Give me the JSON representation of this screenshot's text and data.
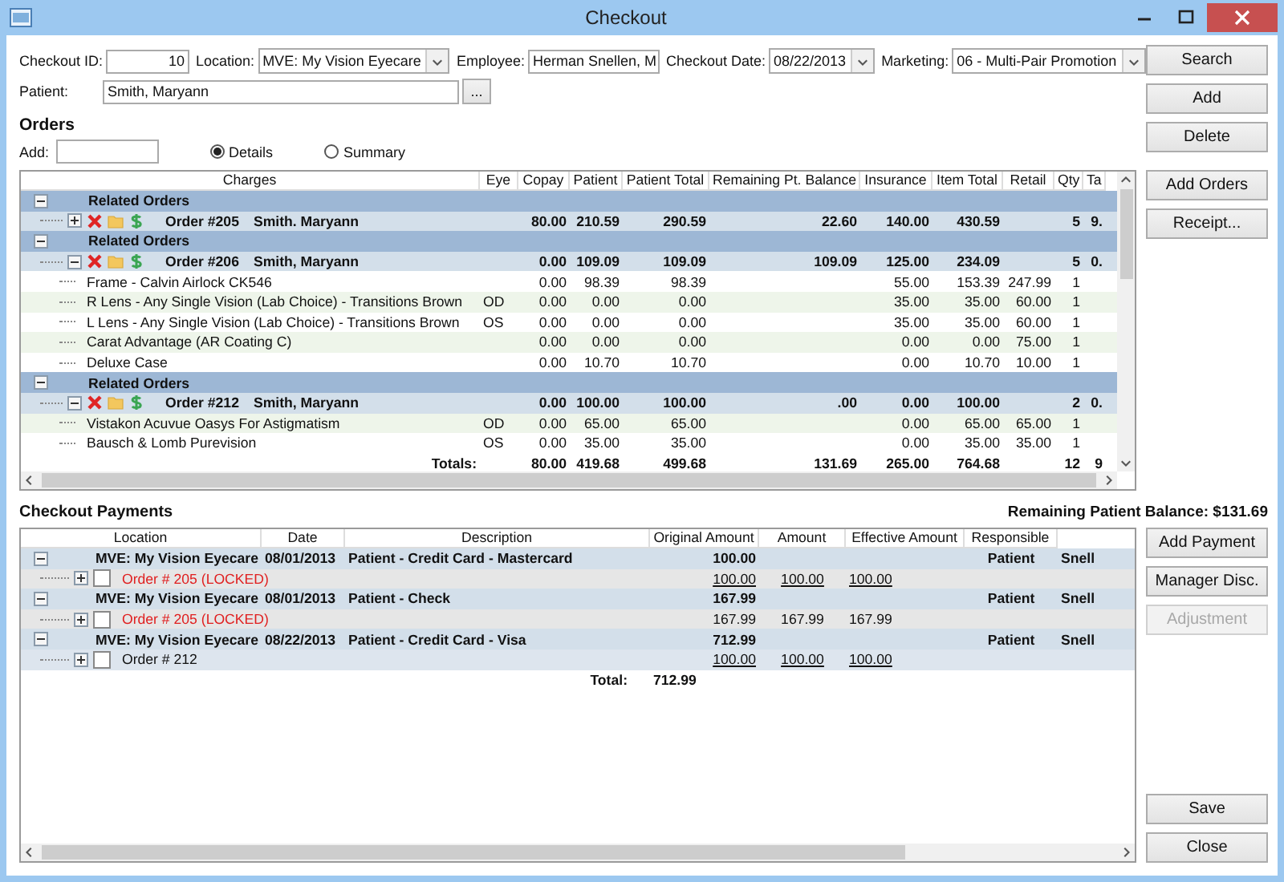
{
  "window": {
    "title": "Checkout"
  },
  "form": {
    "rows": [
      [
        {
          "label": "Checkout ID:",
          "value": "10",
          "kind": "number"
        },
        {
          "label": "Location:",
          "value": "MVE: My Vision Eyecare",
          "kind": "dropdown"
        },
        {
          "label": "Employee:",
          "value": "Herman Snellen, M",
          "kind": "text"
        },
        {
          "label": "Checkout Date:",
          "value": "08/22/2013",
          "kind": "date"
        },
        {
          "label": "Marketing:",
          "value": "06 - Multi-Pair Promotion",
          "kind": "dropdown"
        }
      ],
      [
        {
          "label": "Patient:",
          "value": "Smith, Maryann",
          "kind": "lookup",
          "button": "..."
        }
      ]
    ]
  },
  "top_buttons": [
    "Search",
    "Add",
    "Delete"
  ],
  "orders": {
    "title": "Orders",
    "add_label": "Add:",
    "view_options": [
      {
        "label": "Details",
        "selected": true
      },
      {
        "label": "Summary",
        "selected": false
      }
    ],
    "buttons": [
      "Add Orders",
      "Receipt..."
    ],
    "columns": [
      "Charges",
      "Eye",
      "Copay",
      "Patient",
      "Patient Total",
      "Remaining Pt. Balance",
      "Insurance",
      "Item Total",
      "Retail",
      "Qty",
      "Ta"
    ],
    "rows": [
      {
        "kind": "group",
        "label": "Related Orders",
        "expanded": true,
        "children": [
          {
            "kind": "order",
            "number": "Order #205",
            "patient": "Smith. Maryann",
            "expanded": false,
            "cells": [
              null,
              "80.00",
              "210.59",
              "290.59",
              "22.60",
              "140.00",
              "430.59",
              null,
              "5",
              "9."
            ]
          }
        ]
      },
      {
        "kind": "group",
        "label": "Related Orders",
        "expanded": true,
        "children": [
          {
            "kind": "order",
            "number": "Order #206",
            "patient": "Smith, Maryann",
            "expanded": true,
            "cells": [
              null,
              "0.00",
              "109.09",
              "109.09",
              "109.09",
              "125.00",
              "234.09",
              null,
              "5",
              "0."
            ],
            "children": [
              {
                "kind": "item",
                "description": "Frame - Calvin Airlock CK546",
                "cells": [
                  null,
                  "0.00",
                  "98.39",
                  "98.39",
                  null,
                  "55.00",
                  "153.39",
                  "247.99",
                  "1",
                  null
                ]
              },
              {
                "kind": "item",
                "description": "R Lens - Any Single Vision (Lab Choice) - Transitions Brown",
                "cells": [
                  "OD",
                  "0.00",
                  "0.00",
                  "0.00",
                  null,
                  "35.00",
                  "35.00",
                  "60.00",
                  "1",
                  null
                ]
              },
              {
                "kind": "item",
                "description": "L Lens - Any Single Vision (Lab Choice) - Transitions Brown",
                "cells": [
                  "OS",
                  "0.00",
                  "0.00",
                  "0.00",
                  null,
                  "35.00",
                  "35.00",
                  "60.00",
                  "1",
                  null
                ]
              },
              {
                "kind": "item",
                "description": "Carat Advantage (AR Coating C)",
                "cells": [
                  null,
                  "0.00",
                  "0.00",
                  "0.00",
                  null,
                  "0.00",
                  "0.00",
                  "75.00",
                  "1",
                  null
                ]
              },
              {
                "kind": "item",
                "description": "Deluxe Case",
                "cells": [
                  null,
                  "0.00",
                  "10.70",
                  "10.70",
                  null,
                  "0.00",
                  "10.70",
                  "10.00",
                  "1",
                  null
                ]
              }
            ]
          }
        ]
      },
      {
        "kind": "group",
        "label": "Related Orders",
        "expanded": true,
        "children": [
          {
            "kind": "order",
            "number": "Order #212",
            "patient": "Smith, Maryann",
            "expanded": true,
            "cells": [
              null,
              "0.00",
              "100.00",
              "100.00",
              ".00",
              "0.00",
              "100.00",
              null,
              "2",
              "0."
            ],
            "children": [
              {
                "kind": "item",
                "description": "Vistakon Acuvue Oasys For Astigmatism",
                "cells": [
                  "OD",
                  "0.00",
                  "65.00",
                  "65.00",
                  null,
                  "0.00",
                  "65.00",
                  "65.00",
                  "1",
                  null
                ]
              },
              {
                "kind": "item",
                "description": "Bausch & Lomb Purevision",
                "cells": [
                  "OS",
                  "0.00",
                  "35.00",
                  "35.00",
                  null,
                  "0.00",
                  "35.00",
                  "35.00",
                  "1",
                  null
                ]
              }
            ]
          }
        ]
      }
    ],
    "totals": {
      "label": "Totals:",
      "cells": [
        null,
        "80.00",
        "419.68",
        "499.68",
        "131.69",
        "265.00",
        "764.68",
        null,
        "12",
        "9"
      ]
    }
  },
  "payments": {
    "title": "Checkout Payments",
    "balance": "Remaining Patient Balance: $131.69",
    "buttons": [
      {
        "label": "Add Payment",
        "disabled": false
      },
      {
        "label": "Manager Disc.",
        "disabled": false
      },
      {
        "label": "Adjustment",
        "disabled": true
      }
    ],
    "columns": [
      "Location",
      "Date",
      "Description",
      "Original Amount",
      "Amount",
      "Effective Amount",
      "Responsible"
    ],
    "rows": [
      {
        "location": "MVE: My Vision Eyecare",
        "date": "08/01/2013",
        "description": "Patient - Credit Card - Mastercard",
        "original_amount": "100.00",
        "responsible": "Patient",
        "column_8": "Snell",
        "expanded": true,
        "children": [
          {
            "order": "Order # 205 (LOCKED)",
            "locked": true,
            "checked": false,
            "expanded": false,
            "linked": true,
            "original_amount": "100.00",
            "amount": "100.00",
            "effective_amount": "100.00"
          }
        ]
      },
      {
        "location": "MVE: My Vision Eyecare",
        "date": "08/01/2013",
        "description": "Patient - Check",
        "original_amount": "167.99",
        "responsible": "Patient",
        "column_8": "Snell",
        "expanded": true,
        "children": [
          {
            "order": "Order # 205 (LOCKED)",
            "locked": true,
            "checked": false,
            "expanded": false,
            "linked": false,
            "original_amount": "167.99",
            "amount": "167.99",
            "effective_amount": "167.99"
          }
        ]
      },
      {
        "location": "MVE: My Vision Eyecare",
        "date": "08/22/2013",
        "description": "Patient - Credit Card - Visa",
        "original_amount": "712.99",
        "responsible": "Patient",
        "column_8": "Snell",
        "expanded": true,
        "children": [
          {
            "order": "Order # 212",
            "locked": false,
            "checked": false,
            "expanded": false,
            "linked": true,
            "original_amount": "100.00",
            "amount": "100.00",
            "effective_amount": "100.00"
          }
        ]
      }
    ],
    "total": {
      "label": "Total:",
      "value": "712.99"
    }
  },
  "bottom_buttons": [
    "Save",
    "Close"
  ]
}
